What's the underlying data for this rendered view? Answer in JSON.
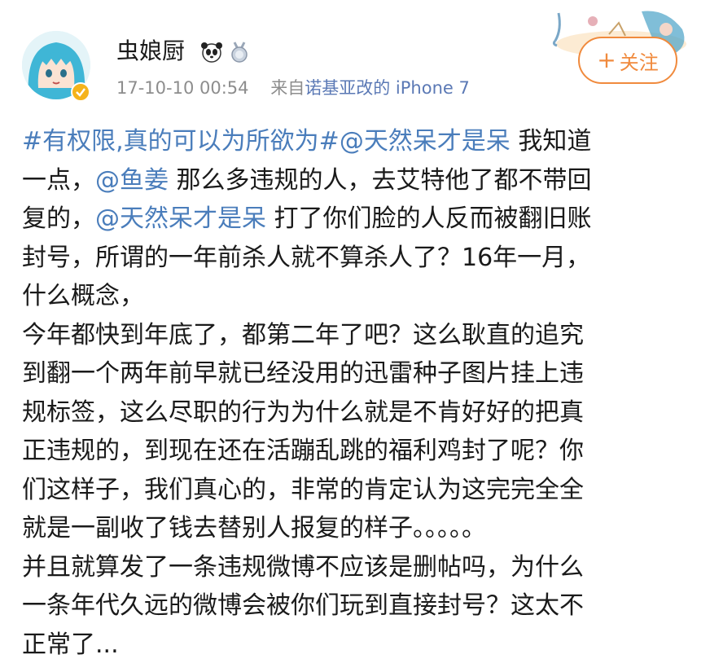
{
  "user": {
    "name": "虫娘厨",
    "badges": [
      "panda-badge",
      "medal-badge"
    ],
    "timestamp": "17-10-10 00:54",
    "source_prefix": "来自",
    "source": "诺基亚改的 iPhone 7"
  },
  "follow": {
    "plus": "+",
    "label": "关注"
  },
  "post": {
    "l1": {
      "a": "#有权限,真的可以为所欲为#",
      "b": "@天然呆才是呆",
      "c": " 我知道"
    },
    "l2": {
      "a": "一点，",
      "b": "@鱼姜",
      "c": " 那么多违规的人，去艾特他了都不带回"
    },
    "l3": {
      "a": "复的，",
      "b": "@天然呆才是呆",
      "c": " 打了你们脸的人反而被翻旧账"
    },
    "l4": "封号，所谓的一年前杀人就不算杀人了？16年一月，",
    "l5": "什么概念，",
    "l6": "今年都快到年底了，都第二年了吧？这么耿直的追究",
    "l7": "到翻一个两年前早就已经没用的迅雷种子图片挂上违",
    "l8": "规标签，这么尽职的行为为什么就是不肯好好的把真",
    "l9": "正违规的，到现在还在活蹦乱跳的福利鸡封了呢？你",
    "l10": "们这样子，我们真心的，非常的肯定认为这完完全全",
    "l11": "就是一副收了钱去替别人报复的样子。。。。。",
    "l12": "并且就算发了一条违规微博不应该是删帖吗，为什么",
    "l13": "一条年代久远的微博会被你们玩到直接封号？这太不",
    "l14": "正常了..."
  },
  "colors": {
    "link": "#4a7dbb",
    "follow": "#f08a3d",
    "verified": "#f5b31b"
  }
}
